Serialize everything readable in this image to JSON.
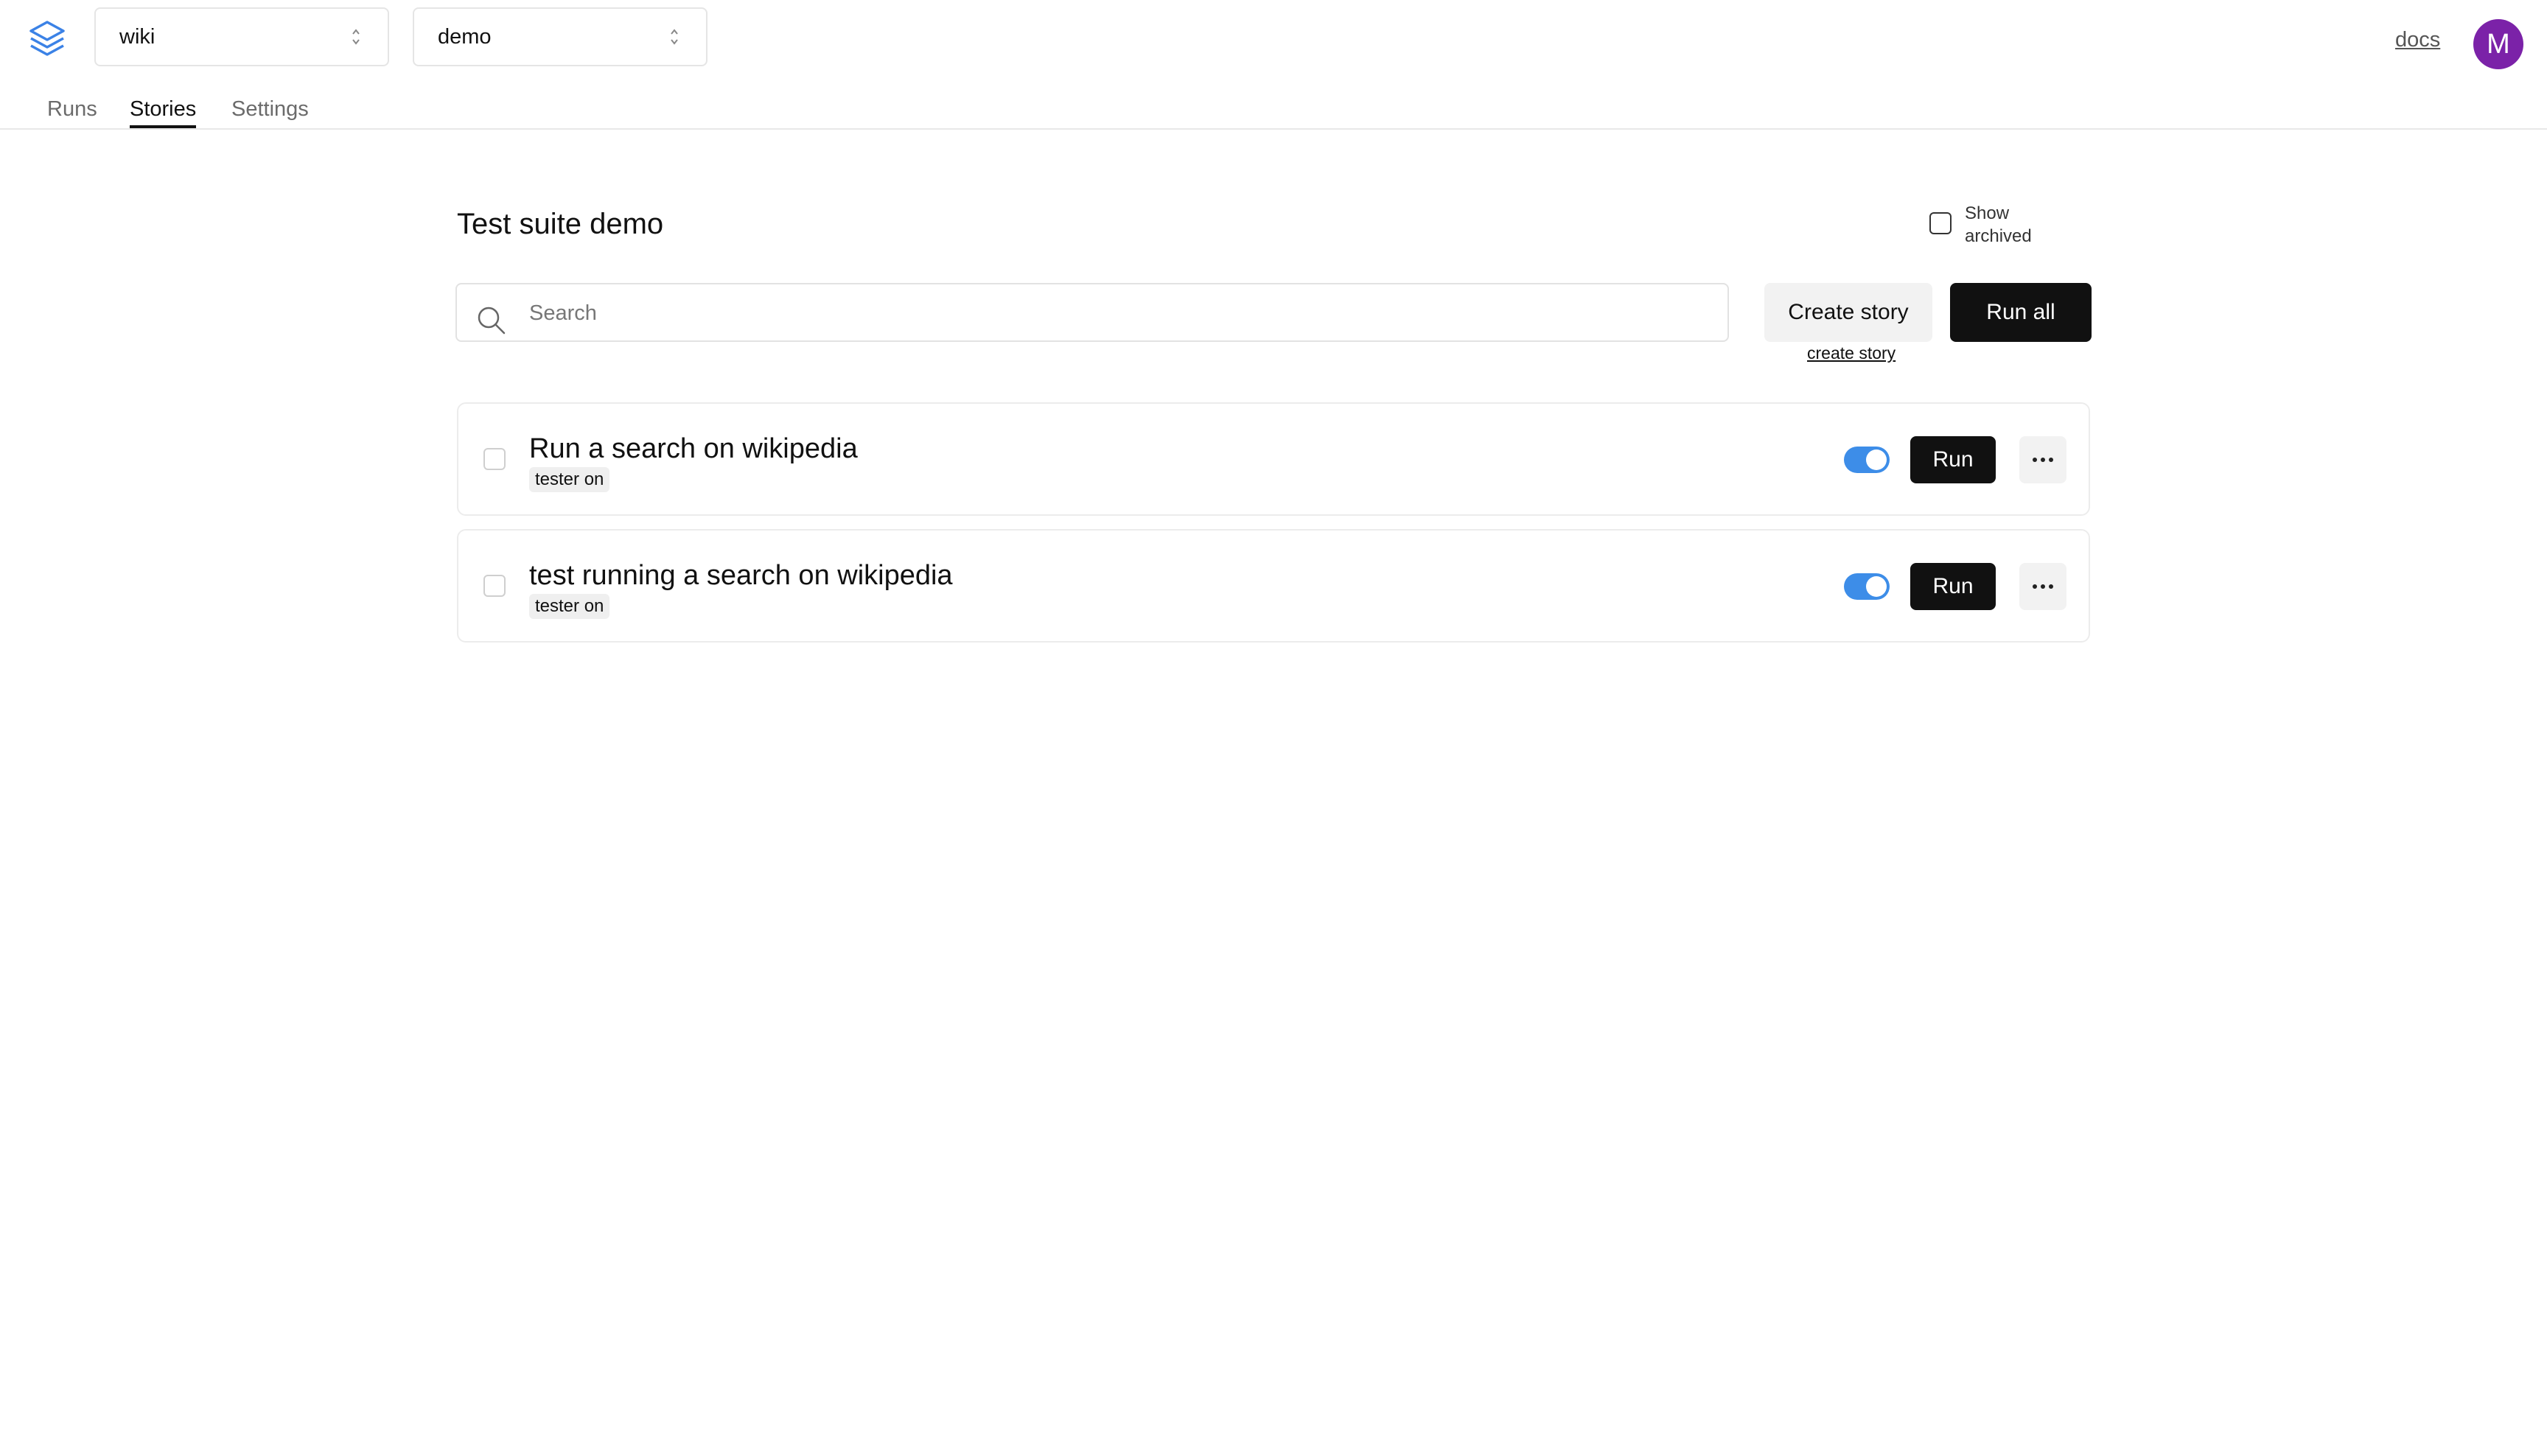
{
  "header": {
    "logo_icon": "stack-layers-icon",
    "project_select": {
      "value": "wiki"
    },
    "suite_select": {
      "value": "demo"
    },
    "docs_label": "docs",
    "avatar_initial": "M",
    "avatar_color": "#7b22a8"
  },
  "tabs": [
    {
      "label": "Runs",
      "active": false
    },
    {
      "label": "Stories",
      "active": true
    },
    {
      "label": "Settings",
      "active": false
    }
  ],
  "main": {
    "title": "Test suite demo",
    "show_archived_label": "Show archived",
    "show_archived_checked": false,
    "search": {
      "placeholder": "Search",
      "value": ""
    },
    "create_story_button": "Create story",
    "create_story_link": "create story",
    "run_all_button": "Run all"
  },
  "stories": [
    {
      "title": "Run a search on wikipedia",
      "tag": "tester on",
      "enabled": true,
      "run_label": "Run"
    },
    {
      "title": "test running a search on wikipedia",
      "tag": "tester on",
      "enabled": true,
      "run_label": "Run"
    }
  ],
  "colors": {
    "accent_toggle": "#3d8de8",
    "primary_button": "#111111",
    "secondary_button": "#f2f2f2",
    "logo": "#3b82e6"
  }
}
